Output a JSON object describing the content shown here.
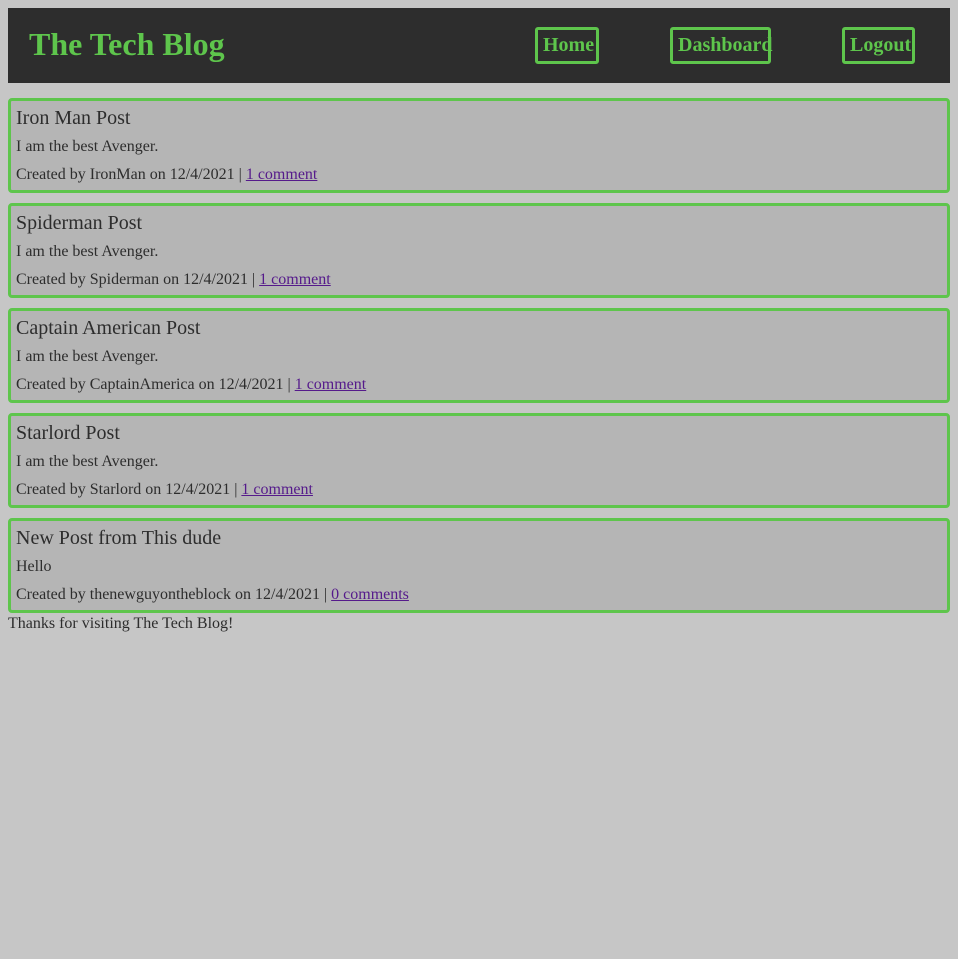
{
  "header": {
    "title": "The Tech Blog",
    "nav": {
      "home": "Home",
      "dashboard": "Dashboard",
      "logout": "Logout"
    }
  },
  "posts": [
    {
      "title": "Iron Man Post",
      "body": "I am the best Avenger.",
      "created_prefix": "Created by",
      "author": "IronMan",
      "on": "on",
      "date": "12/4/2021",
      "separator": "|",
      "comments": "1 comment"
    },
    {
      "title": "Spiderman Post",
      "body": "I am the best Avenger.",
      "created_prefix": "Created by",
      "author": "Spiderman",
      "on": "on",
      "date": "12/4/2021",
      "separator": "|",
      "comments": "1 comment"
    },
    {
      "title": "Captain American Post",
      "body": "I am the best Avenger.",
      "created_prefix": "Created by",
      "author": "CaptainAmerica",
      "on": "on",
      "date": "12/4/2021",
      "separator": "|",
      "comments": "1 comment"
    },
    {
      "title": "Starlord Post",
      "body": "I am the best Avenger.",
      "created_prefix": "Created by",
      "author": "Starlord",
      "on": "on",
      "date": "12/4/2021",
      "separator": "|",
      "comments": "1 comment"
    },
    {
      "title": "New Post from This dude",
      "body": "Hello",
      "created_prefix": "Created by",
      "author": "thenewguyontheblock",
      "on": "on",
      "date": "12/4/2021",
      "separator": "|",
      "comments": "0 comments"
    }
  ],
  "footer": {
    "text": "Thanks for visiting The Tech Blog!"
  },
  "colors": {
    "accent": "#5ec54c",
    "header_bg": "#2d2d2d",
    "page_bg": "#c6c6c6",
    "card_bg": "#b5b5b5",
    "link": "#551a8b"
  }
}
